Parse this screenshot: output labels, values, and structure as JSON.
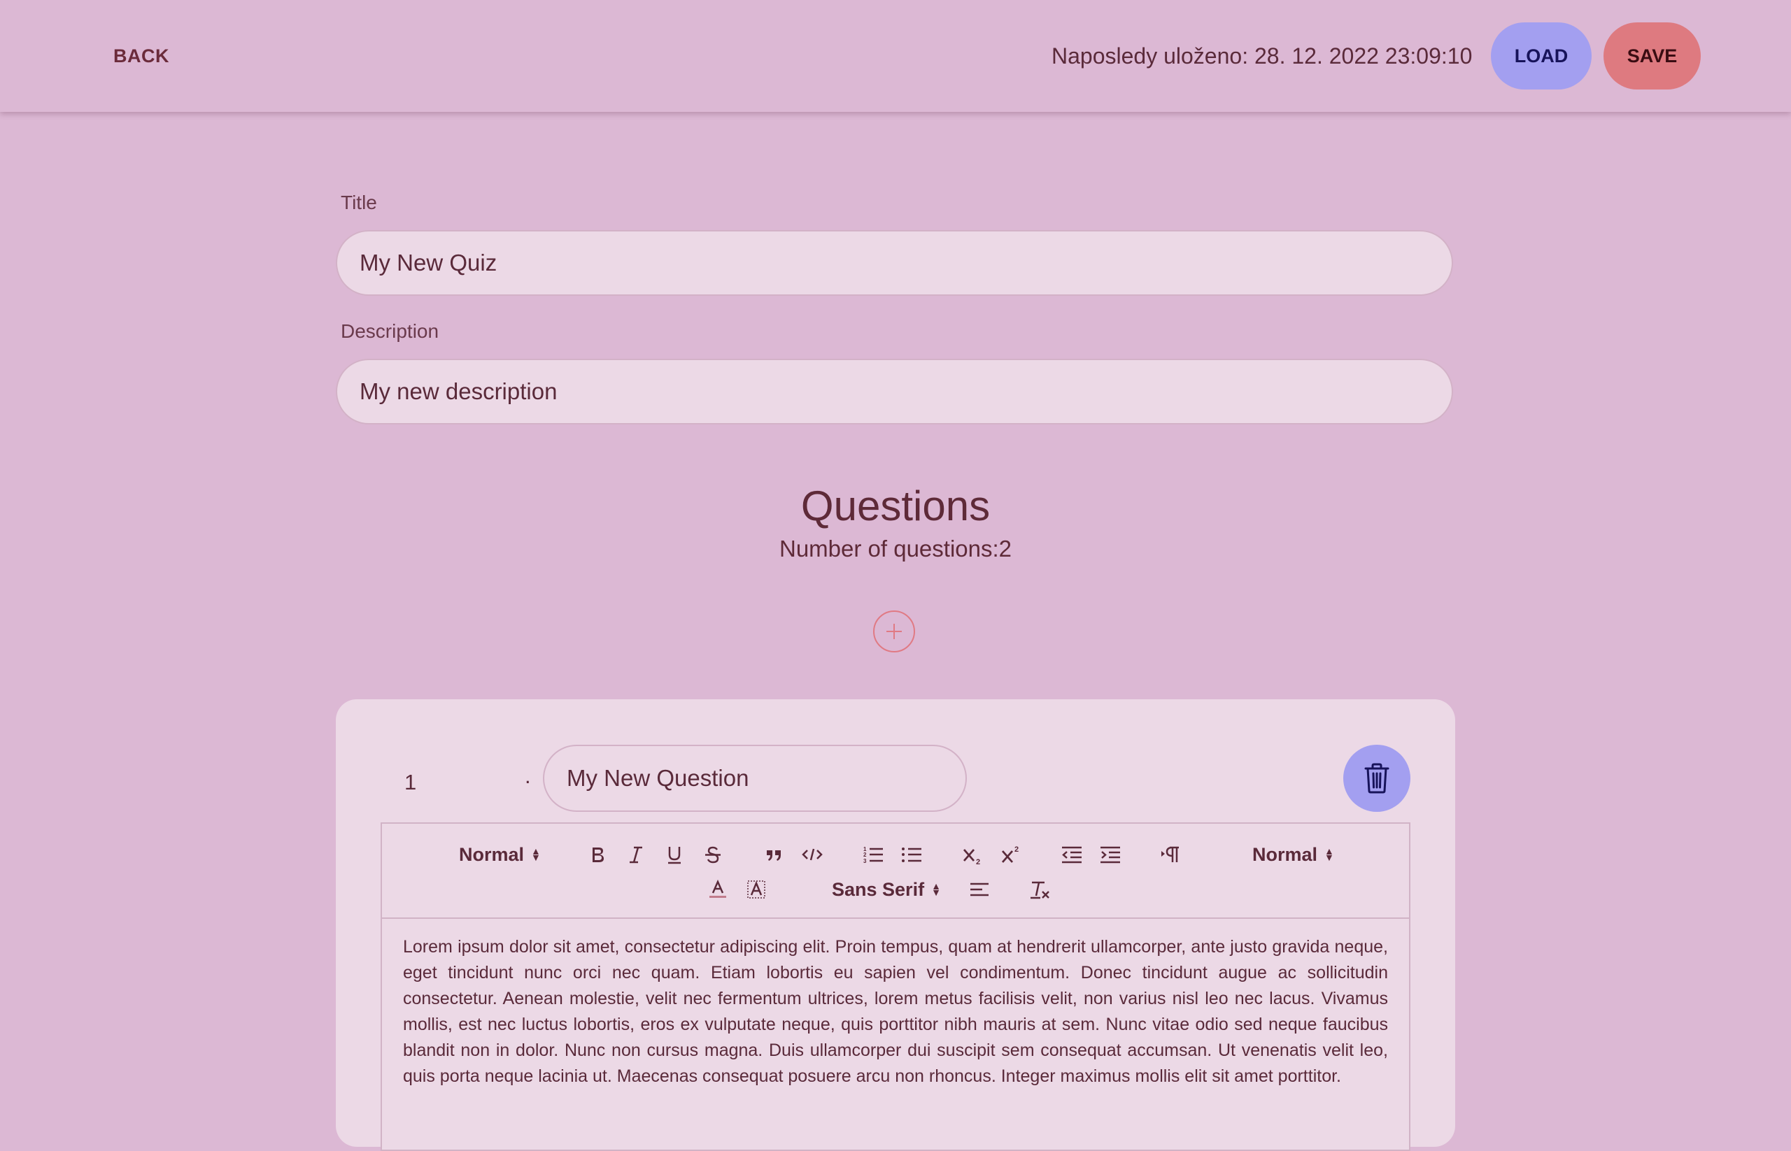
{
  "topbar": {
    "back_label": "BACK",
    "last_saved": "Naposledy uloženo: 28. 12. 2022 23:09:10",
    "load_label": "LOAD",
    "save_label": "SAVE"
  },
  "form": {
    "title_label": "Title",
    "title_value": "My New Quiz",
    "description_label": "Description",
    "description_value": "My new description"
  },
  "questions": {
    "heading": "Questions",
    "count_text": "Number of questions:2",
    "add_icon": "plus-icon"
  },
  "question_1": {
    "number": "1",
    "dot": ".",
    "title_value": "My New Question",
    "delete_icon": "trash-icon",
    "toolbar": {
      "header_select": "Normal",
      "size_select": "Normal",
      "font_select": "Sans Serif",
      "icons": [
        "bold-icon",
        "italic-icon",
        "underline-icon",
        "strikethrough-icon",
        "blockquote-icon",
        "code-icon",
        "ordered-list-icon",
        "bullet-list-icon",
        "subscript-icon",
        "superscript-icon",
        "outdent-icon",
        "indent-icon",
        "text-direction-icon",
        "font-color-icon",
        "background-color-icon",
        "align-icon",
        "clear-format-icon"
      ]
    },
    "body_text": "Lorem ipsum dolor sit amet, consectetur adipiscing elit. Proin tempus, quam at hendrerit ullamcorper, ante justo gravida neque, eget tincidunt nunc orci nec quam. Etiam lobortis eu sapien vel condimentum. Donec tincidunt augue ac sollicitudin consectetur. Aenean molestie, velit nec fermentum ultrices, lorem metus facilisis velit, non varius nisl leo nec lacus. Vivamus mollis, est nec luctus lobortis, eros ex vulputate neque, quis porttitor nibh mauris at sem. Nunc vitae odio sed neque faucibus blandit non in dolor. Nunc non cursus magna. Duis ullamcorper dui suscipit sem consequat accumsan. Ut venenatis velit leo, quis porta neque lacinia ut. Maecenas consequat posuere arcu non rhoncus. Integer maximus mollis elit sit amet porttitor."
  },
  "colors": {
    "background": "#dcb8d4",
    "field_bg": "#ecd9e6",
    "load": "#a39ff0",
    "save": "#de7a80",
    "text": "#5a2a3a"
  }
}
